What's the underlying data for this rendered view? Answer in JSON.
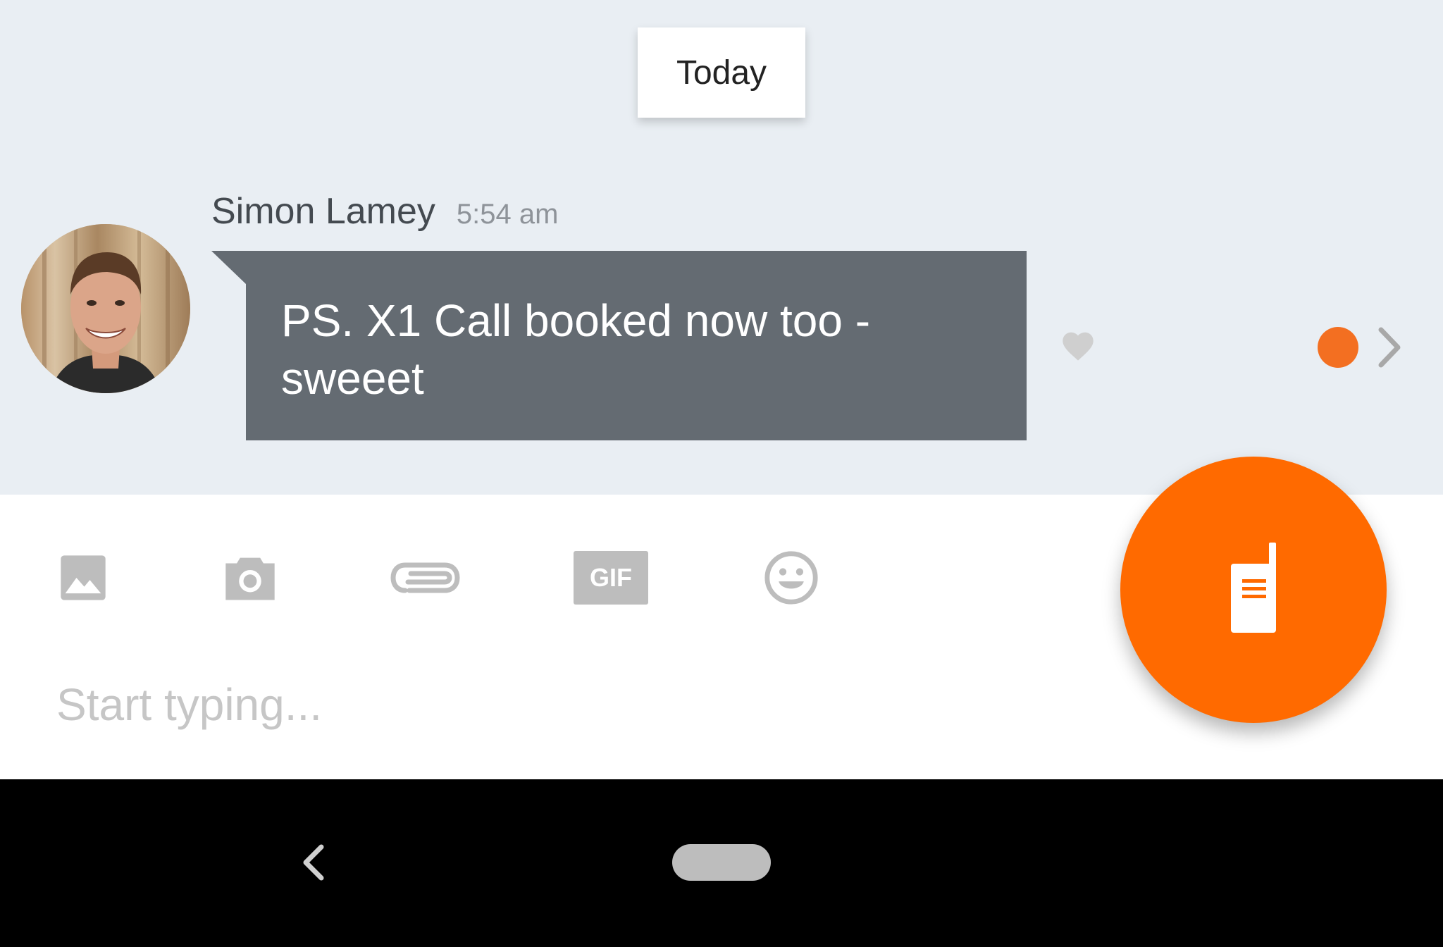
{
  "chat": {
    "date_separator": "Today",
    "message": {
      "sender": "Simon Lamey",
      "time": "5:54 am",
      "text": "PS. X1 Call booked now too - sweeet",
      "liked": false,
      "status_color": "#f36f21"
    }
  },
  "composer": {
    "tools": [
      {
        "name": "image-icon"
      },
      {
        "name": "camera-icon"
      },
      {
        "name": "attachment-icon"
      },
      {
        "name": "gif",
        "label": "GIF"
      },
      {
        "name": "emoji-icon"
      }
    ],
    "placeholder": "Start typing...",
    "fab_icon": "walkie-talkie-icon",
    "accent_color": "#ff6a00"
  },
  "navbar": {
    "buttons": [
      "back",
      "home"
    ]
  }
}
